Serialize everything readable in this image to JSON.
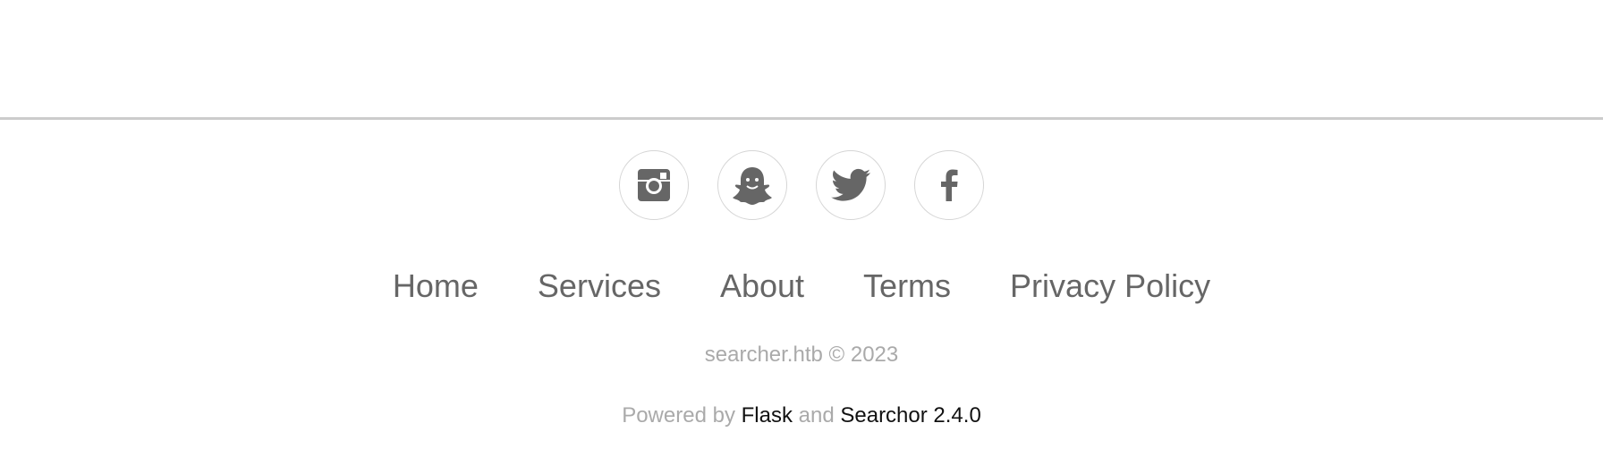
{
  "footer": {
    "social": [
      {
        "icon": "instagram-icon"
      },
      {
        "icon": "snapchat-icon"
      },
      {
        "icon": "twitter-icon"
      },
      {
        "icon": "facebook-icon"
      }
    ],
    "links": [
      "Home",
      "Services",
      "About",
      "Terms",
      "Privacy Policy"
    ],
    "copyright": "searcher.htb © 2023",
    "powered_prefix": "Powered by",
    "powered_flask": "Flask",
    "powered_and": "and",
    "powered_searchor": "Searchor 2.4.0"
  },
  "colors": {
    "icon": "#666666",
    "link": "#666666",
    "muted": "#aaaaaa",
    "divider": "#cccccc",
    "circle_border": "#d5d5d5"
  }
}
